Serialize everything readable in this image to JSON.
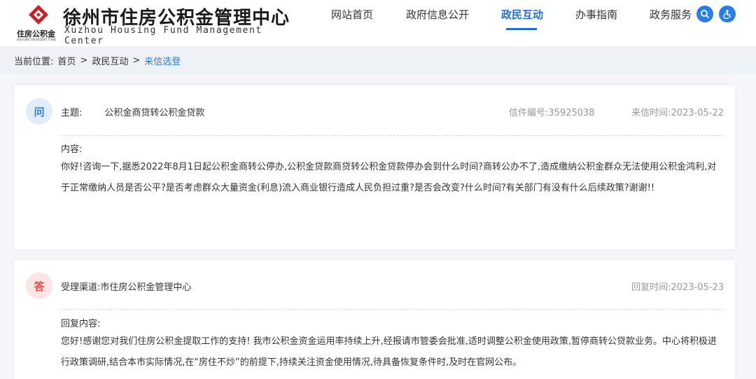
{
  "header": {
    "logo_small_cn": "住房公积金",
    "logo_small_en": "HOUSING PROVIDENT FUND",
    "title": "徐州市住房公积金管理中心",
    "title_en": "Xuzhou Housing Fund Management Center",
    "nav": [
      {
        "label": "网站首页"
      },
      {
        "label": "政府信息公开"
      },
      {
        "label": "政民互动",
        "active": true
      },
      {
        "label": "办事指南"
      },
      {
        "label": "政务服务"
      }
    ],
    "icons": [
      "search-icon",
      "accessibility-icon"
    ],
    "accent_color": "#2a7de1"
  },
  "breadcrumb": {
    "prefix": "当前位置:",
    "items": [
      "首页",
      "政民互动",
      "来信选登"
    ],
    "separator": ">"
  },
  "question": {
    "badge": "问",
    "subject_label": "主题:",
    "subject": "公积金商贷转公积金贷款",
    "letter_no": "信件编号:35925038",
    "date": "来信时间:2023-05-22",
    "content_label": "内容:",
    "content": "你好!咨询一下,据悉2022年8月1日起公积金商转公停办,公积金贷款商贷转公积金贷款停办会到什么时间?商转公办不了,造成缴纳公积金群众无法使用公积金鸿利,对于正常缴纳人员是否公平?是否考虑群众大量资金(利息)流入商业银行造成人民负担过重?是否会改变?什么时间?有关部门有没有什么后续政策?谢谢!!"
  },
  "answer": {
    "badge": "答",
    "channel": "受理渠道:市住房公积金管理中心",
    "date": "回复时间:2023-05-23",
    "content_label": "回复内容:",
    "content": "您好!感谢您对我们住房公积金提取工作的支持! 我市公积金资金运用率持续上升,经报请市管委会批准,适时调整公积金使用政策,暂停商转公贷款业务。中心将积极进行政策调研,结合本市实际情况,在“房住不炒”的前提下,持续关注资金使用情况,待具备恢复条件时,及时在官网公布。"
  }
}
